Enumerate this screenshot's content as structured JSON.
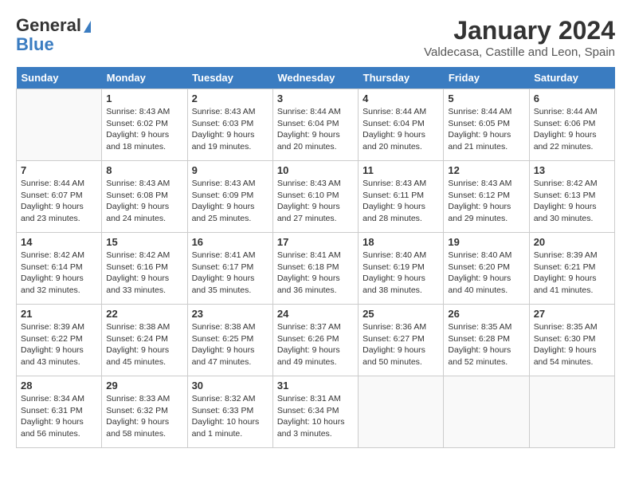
{
  "logo": {
    "general": "General",
    "blue": "Blue"
  },
  "title": "January 2024",
  "location": "Valdecasa, Castille and Leon, Spain",
  "days": [
    "Sunday",
    "Monday",
    "Tuesday",
    "Wednesday",
    "Thursday",
    "Friday",
    "Saturday"
  ],
  "weeks": [
    [
      {
        "date": "",
        "sunrise": "",
        "sunset": "",
        "daylight": ""
      },
      {
        "date": "1",
        "sunrise": "Sunrise: 8:43 AM",
        "sunset": "Sunset: 6:02 PM",
        "daylight": "Daylight: 9 hours and 18 minutes."
      },
      {
        "date": "2",
        "sunrise": "Sunrise: 8:43 AM",
        "sunset": "Sunset: 6:03 PM",
        "daylight": "Daylight: 9 hours and 19 minutes."
      },
      {
        "date": "3",
        "sunrise": "Sunrise: 8:44 AM",
        "sunset": "Sunset: 6:04 PM",
        "daylight": "Daylight: 9 hours and 20 minutes."
      },
      {
        "date": "4",
        "sunrise": "Sunrise: 8:44 AM",
        "sunset": "Sunset: 6:04 PM",
        "daylight": "Daylight: 9 hours and 20 minutes."
      },
      {
        "date": "5",
        "sunrise": "Sunrise: 8:44 AM",
        "sunset": "Sunset: 6:05 PM",
        "daylight": "Daylight: 9 hours and 21 minutes."
      },
      {
        "date": "6",
        "sunrise": "Sunrise: 8:44 AM",
        "sunset": "Sunset: 6:06 PM",
        "daylight": "Daylight: 9 hours and 22 minutes."
      }
    ],
    [
      {
        "date": "7",
        "sunrise": "Sunrise: 8:44 AM",
        "sunset": "Sunset: 6:07 PM",
        "daylight": "Daylight: 9 hours and 23 minutes."
      },
      {
        "date": "8",
        "sunrise": "Sunrise: 8:43 AM",
        "sunset": "Sunset: 6:08 PM",
        "daylight": "Daylight: 9 hours and 24 minutes."
      },
      {
        "date": "9",
        "sunrise": "Sunrise: 8:43 AM",
        "sunset": "Sunset: 6:09 PM",
        "daylight": "Daylight: 9 hours and 25 minutes."
      },
      {
        "date": "10",
        "sunrise": "Sunrise: 8:43 AM",
        "sunset": "Sunset: 6:10 PM",
        "daylight": "Daylight: 9 hours and 27 minutes."
      },
      {
        "date": "11",
        "sunrise": "Sunrise: 8:43 AM",
        "sunset": "Sunset: 6:11 PM",
        "daylight": "Daylight: 9 hours and 28 minutes."
      },
      {
        "date": "12",
        "sunrise": "Sunrise: 8:43 AM",
        "sunset": "Sunset: 6:12 PM",
        "daylight": "Daylight: 9 hours and 29 minutes."
      },
      {
        "date": "13",
        "sunrise": "Sunrise: 8:42 AM",
        "sunset": "Sunset: 6:13 PM",
        "daylight": "Daylight: 9 hours and 30 minutes."
      }
    ],
    [
      {
        "date": "14",
        "sunrise": "Sunrise: 8:42 AM",
        "sunset": "Sunset: 6:14 PM",
        "daylight": "Daylight: 9 hours and 32 minutes."
      },
      {
        "date": "15",
        "sunrise": "Sunrise: 8:42 AM",
        "sunset": "Sunset: 6:16 PM",
        "daylight": "Daylight: 9 hours and 33 minutes."
      },
      {
        "date": "16",
        "sunrise": "Sunrise: 8:41 AM",
        "sunset": "Sunset: 6:17 PM",
        "daylight": "Daylight: 9 hours and 35 minutes."
      },
      {
        "date": "17",
        "sunrise": "Sunrise: 8:41 AM",
        "sunset": "Sunset: 6:18 PM",
        "daylight": "Daylight: 9 hours and 36 minutes."
      },
      {
        "date": "18",
        "sunrise": "Sunrise: 8:40 AM",
        "sunset": "Sunset: 6:19 PM",
        "daylight": "Daylight: 9 hours and 38 minutes."
      },
      {
        "date": "19",
        "sunrise": "Sunrise: 8:40 AM",
        "sunset": "Sunset: 6:20 PM",
        "daylight": "Daylight: 9 hours and 40 minutes."
      },
      {
        "date": "20",
        "sunrise": "Sunrise: 8:39 AM",
        "sunset": "Sunset: 6:21 PM",
        "daylight": "Daylight: 9 hours and 41 minutes."
      }
    ],
    [
      {
        "date": "21",
        "sunrise": "Sunrise: 8:39 AM",
        "sunset": "Sunset: 6:22 PM",
        "daylight": "Daylight: 9 hours and 43 minutes."
      },
      {
        "date": "22",
        "sunrise": "Sunrise: 8:38 AM",
        "sunset": "Sunset: 6:24 PM",
        "daylight": "Daylight: 9 hours and 45 minutes."
      },
      {
        "date": "23",
        "sunrise": "Sunrise: 8:38 AM",
        "sunset": "Sunset: 6:25 PM",
        "daylight": "Daylight: 9 hours and 47 minutes."
      },
      {
        "date": "24",
        "sunrise": "Sunrise: 8:37 AM",
        "sunset": "Sunset: 6:26 PM",
        "daylight": "Daylight: 9 hours and 49 minutes."
      },
      {
        "date": "25",
        "sunrise": "Sunrise: 8:36 AM",
        "sunset": "Sunset: 6:27 PM",
        "daylight": "Daylight: 9 hours and 50 minutes."
      },
      {
        "date": "26",
        "sunrise": "Sunrise: 8:35 AM",
        "sunset": "Sunset: 6:28 PM",
        "daylight": "Daylight: 9 hours and 52 minutes."
      },
      {
        "date": "27",
        "sunrise": "Sunrise: 8:35 AM",
        "sunset": "Sunset: 6:30 PM",
        "daylight": "Daylight: 9 hours and 54 minutes."
      }
    ],
    [
      {
        "date": "28",
        "sunrise": "Sunrise: 8:34 AM",
        "sunset": "Sunset: 6:31 PM",
        "daylight": "Daylight: 9 hours and 56 minutes."
      },
      {
        "date": "29",
        "sunrise": "Sunrise: 8:33 AM",
        "sunset": "Sunset: 6:32 PM",
        "daylight": "Daylight: 9 hours and 58 minutes."
      },
      {
        "date": "30",
        "sunrise": "Sunrise: 8:32 AM",
        "sunset": "Sunset: 6:33 PM",
        "daylight": "Daylight: 10 hours and 1 minute."
      },
      {
        "date": "31",
        "sunrise": "Sunrise: 8:31 AM",
        "sunset": "Sunset: 6:34 PM",
        "daylight": "Daylight: 10 hours and 3 minutes."
      },
      {
        "date": "",
        "sunrise": "",
        "sunset": "",
        "daylight": ""
      },
      {
        "date": "",
        "sunrise": "",
        "sunset": "",
        "daylight": ""
      },
      {
        "date": "",
        "sunrise": "",
        "sunset": "",
        "daylight": ""
      }
    ]
  ]
}
